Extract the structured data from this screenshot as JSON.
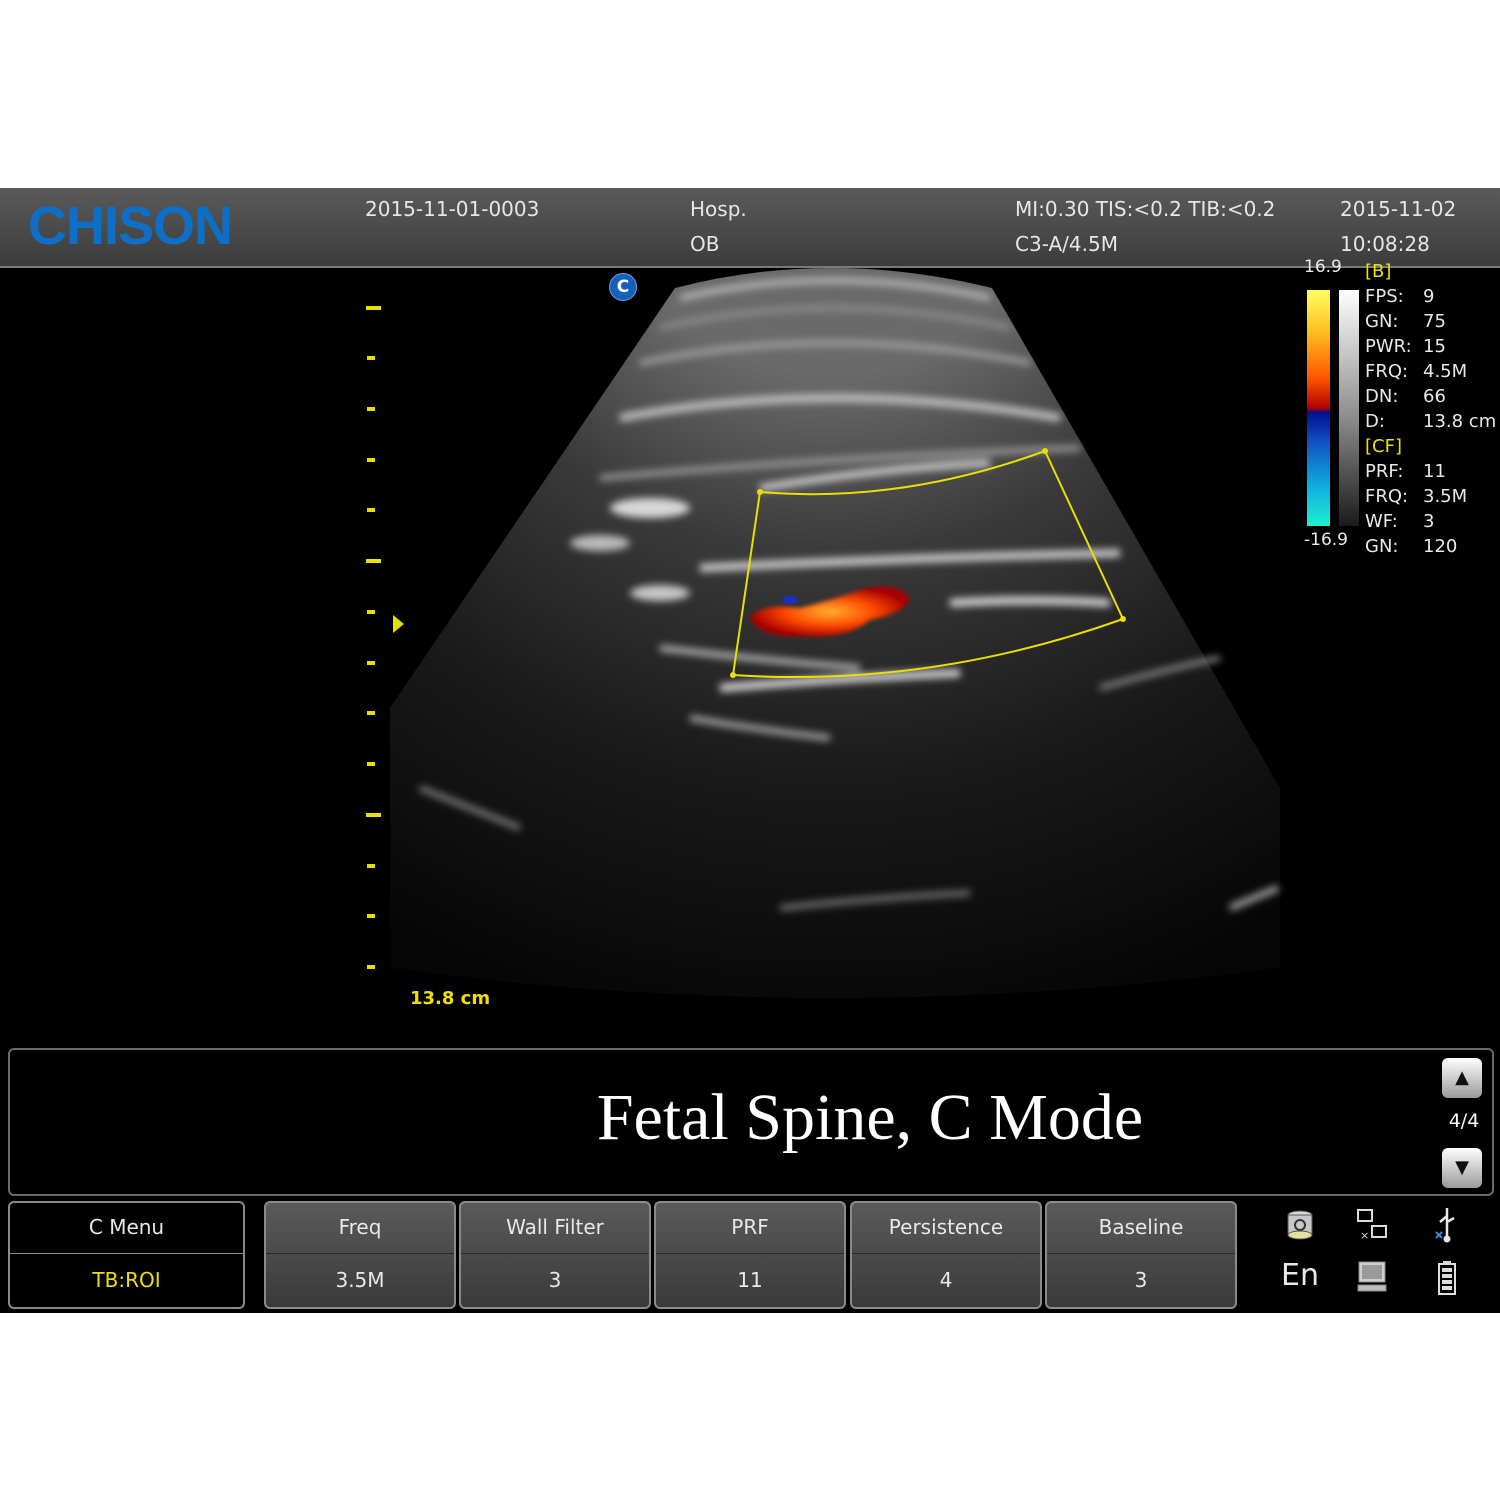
{
  "header": {
    "brand": "CHISON",
    "patient_id": "2015-11-01-0003",
    "hospital": "Hosp.",
    "exam_type": "OB",
    "safety_indices": "MI:0.30  TIS:<0.2  TIB:<0.2",
    "probe": "C3-A/4.5M",
    "date": "2015-11-02",
    "time": "10:08:28"
  },
  "image": {
    "mode_badge": "C",
    "depth_label": "13.8 cm"
  },
  "colorbar": {
    "max": "16.9",
    "min": "-16.9"
  },
  "params": {
    "b_header": "[B]",
    "b": [
      {
        "key": "FPS:",
        "value": "9"
      },
      {
        "key": "GN:",
        "value": "75"
      },
      {
        "key": "PWR:",
        "value": "15"
      },
      {
        "key": "FRQ:",
        "value": "4.5M"
      },
      {
        "key": "DN:",
        "value": "66"
      },
      {
        "key": "D:",
        "value": "13.8 cm"
      }
    ],
    "cf_header": "[CF]",
    "cf": [
      {
        "key": "PRF:",
        "value": "11"
      },
      {
        "key": "FRQ:",
        "value": "3.5M"
      },
      {
        "key": "WF:",
        "value": "3"
      },
      {
        "key": "GN:",
        "value": "120"
      }
    ]
  },
  "caption": {
    "text": "Fetal Spine, C Mode",
    "page": "4/4",
    "up_icon": "up-arrow-icon",
    "down_icon": "down-arrow-icon"
  },
  "controls": {
    "menu": {
      "label": "C Menu",
      "value": "TB:ROI"
    },
    "knobs": [
      {
        "label": "Freq",
        "value": "3.5M"
      },
      {
        "label": "Wall Filter",
        "value": "3"
      },
      {
        "label": "PRF",
        "value": "11"
      },
      {
        "label": "Persistence",
        "value": "4"
      },
      {
        "label": "Baseline",
        "value": "3"
      }
    ]
  },
  "status": {
    "language": "En",
    "icons": [
      "database-icon",
      "network-icon",
      "usb-icon",
      "computer-icon",
      "battery-icon"
    ]
  },
  "colors": {
    "accent_yellow": "#f0e000",
    "brand_blue": "#0e6fc8"
  }
}
